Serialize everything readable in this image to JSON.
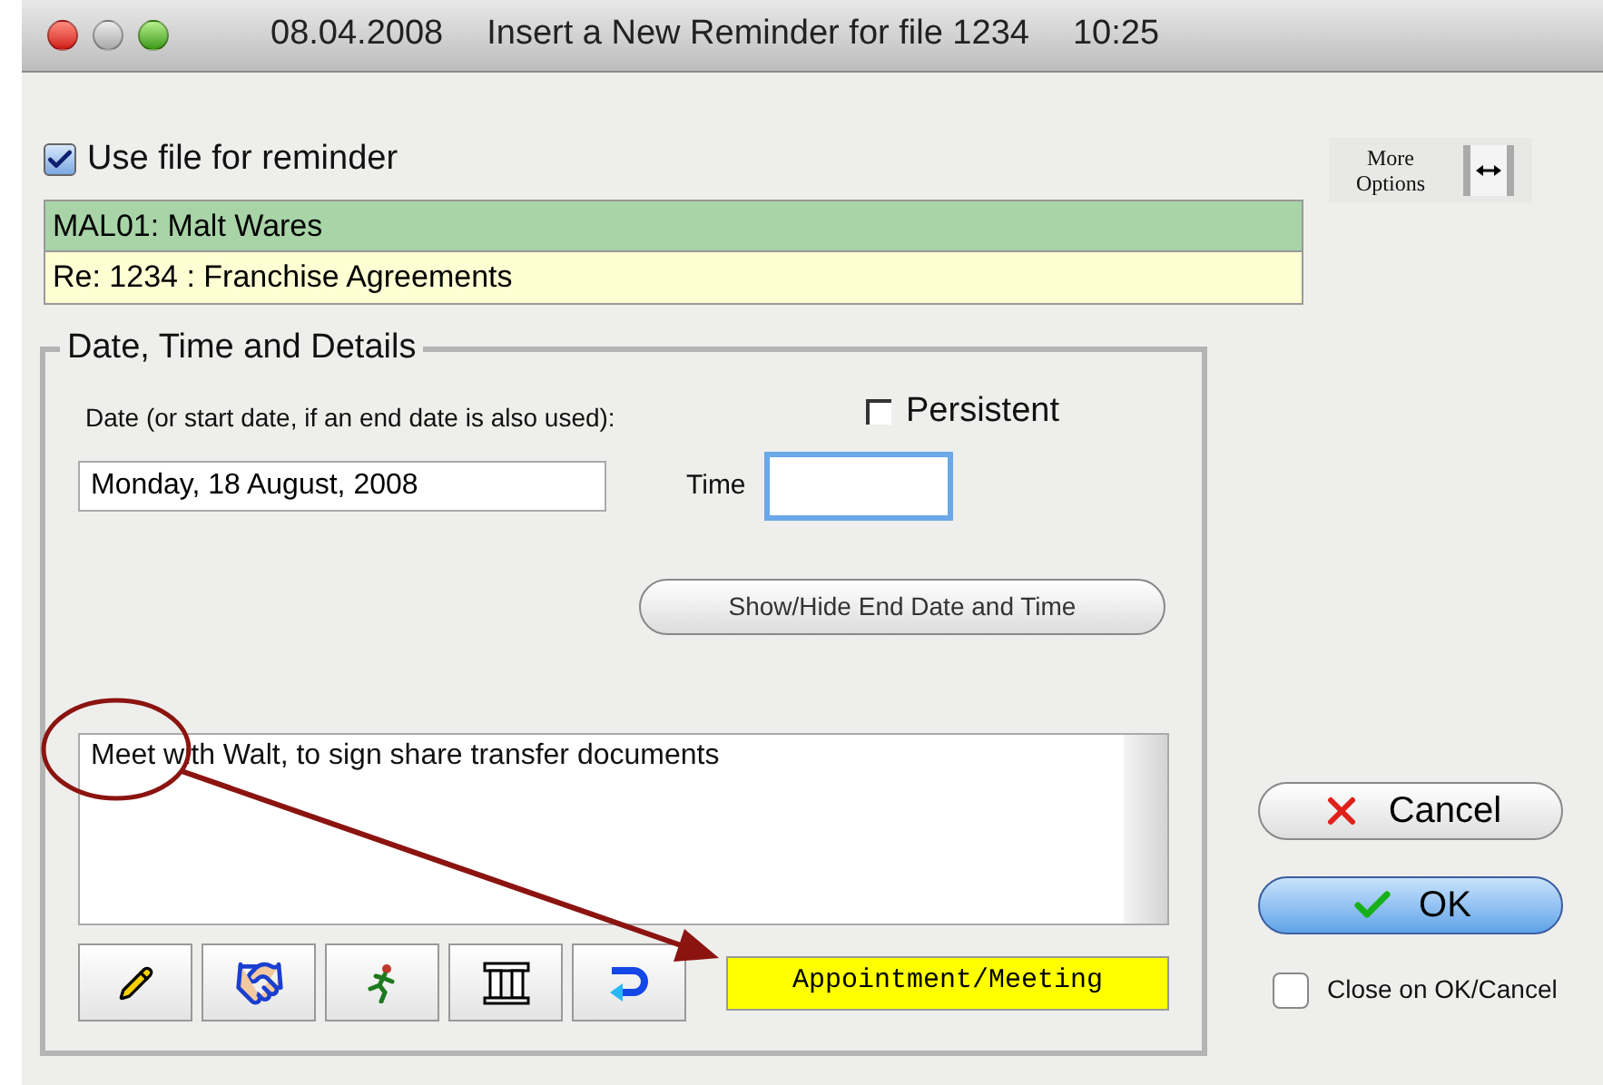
{
  "window": {
    "title_parts": [
      "08.04.2008",
      "Insert a New Reminder for file 1234",
      "10:25"
    ]
  },
  "use_file": {
    "label": "Use file for reminder",
    "checked": true
  },
  "file_rows": [
    {
      "text": "MAL01: Malt Wares",
      "color": "#a8d4a8"
    },
    {
      "text": "Re: 1234 : Franchise Agreements",
      "color": "#ffffd4"
    }
  ],
  "more_options": {
    "label": "More Options"
  },
  "group": {
    "title": "Date, Time and Details"
  },
  "date": {
    "label": "Date (or start date, if an end date is also used):",
    "value": "Monday, 18 August, 2008"
  },
  "persistent": {
    "label": "Persistent",
    "checked": false
  },
  "time": {
    "label": "Time",
    "focused": true
  },
  "show_hide_button": "Show/Hide End Date and Time",
  "details": {
    "text": "Meet with Walt, to sign share transfer documents"
  },
  "tool_buttons": [
    {
      "kind": "pencil"
    },
    {
      "kind": "handshake"
    },
    {
      "kind": "runner"
    },
    {
      "kind": "columns"
    },
    {
      "kind": "return"
    }
  ],
  "category": {
    "label": "Appointment/Meeting",
    "color": "#ffff00"
  },
  "buttons": [
    {
      "kind": "cancel",
      "label": "Cancel"
    },
    {
      "kind": "ok",
      "label": "OK"
    }
  ],
  "close_on_ok": {
    "label": "Close on OK/Cancel",
    "checked": false
  }
}
